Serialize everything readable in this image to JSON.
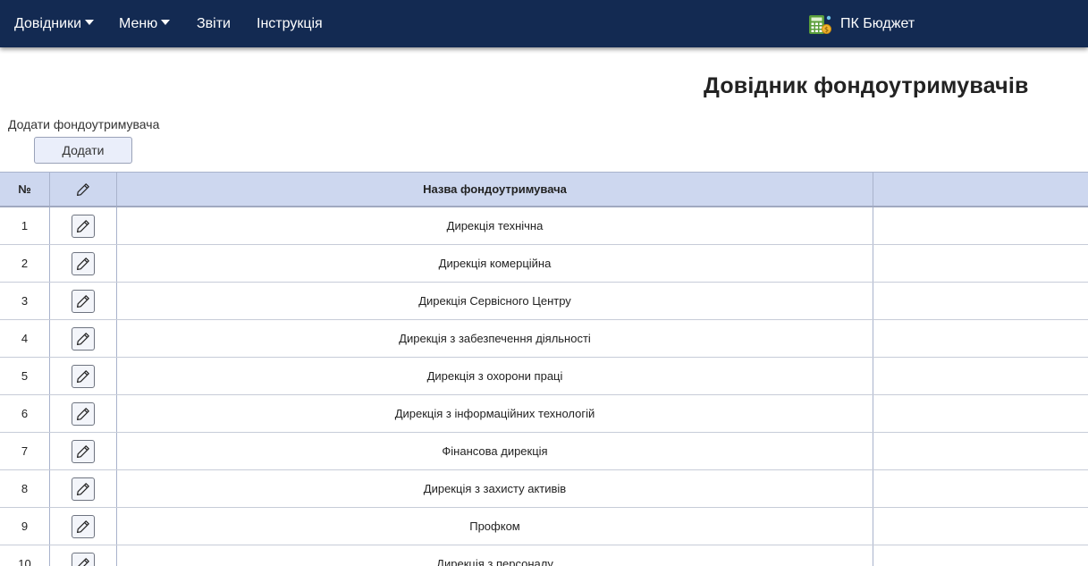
{
  "nav": {
    "items": [
      {
        "label": "Довідники",
        "dropdown": true
      },
      {
        "label": "Меню",
        "dropdown": true
      },
      {
        "label": "Звіти",
        "dropdown": false
      },
      {
        "label": "Інструкція",
        "dropdown": false
      }
    ],
    "brand_label": "ПК Бюджет",
    "brand_icon": "calculator-money-icon"
  },
  "page": {
    "title": "Довідник фондоутримувачів",
    "add_label": "Додати фондоутримувача",
    "add_button": "Додати"
  },
  "table": {
    "headers": {
      "num": "№",
      "edit_icon": "pencil-icon",
      "name": "Назва фондоутримувача",
      "extra": ""
    },
    "rows": [
      {
        "num": "1",
        "name": "Дирекція технічна"
      },
      {
        "num": "2",
        "name": "Дирекція комерційна"
      },
      {
        "num": "3",
        "name": "Дирекція Сервісного Центру"
      },
      {
        "num": "4",
        "name": "Дирекція з забезпечення діяльності"
      },
      {
        "num": "5",
        "name": "Дирекція з охорони праці"
      },
      {
        "num": "6",
        "name": "Дирекція з інформаційних технологій"
      },
      {
        "num": "7",
        "name": "Фінансова дирекція"
      },
      {
        "num": "8",
        "name": "Дирекція з захисту активів"
      },
      {
        "num": "9",
        "name": "Профком"
      },
      {
        "num": "10",
        "name": "Дирекція з персоналу"
      }
    ]
  },
  "colors": {
    "navbar": "#132a52",
    "header_bg": "#cdd7ef",
    "button_bg": "#eaeefa"
  }
}
